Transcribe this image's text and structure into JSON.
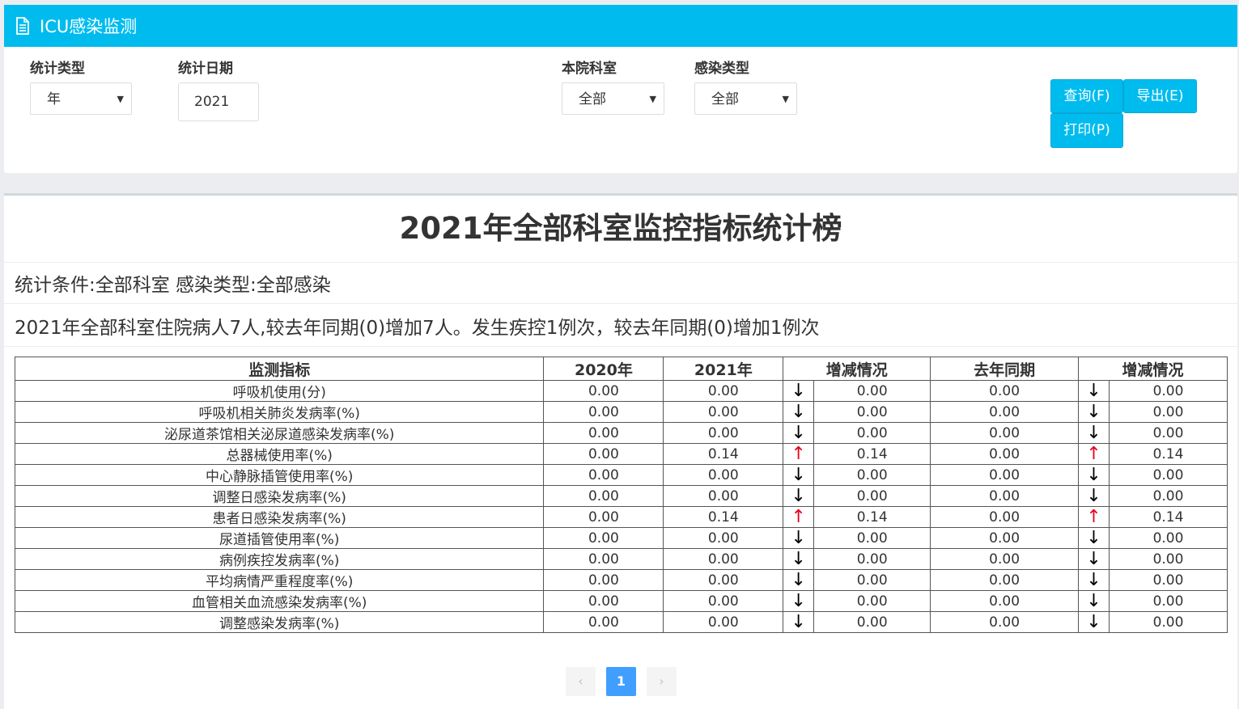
{
  "header": {
    "title": "ICU感染监测",
    "icon": "document-icon"
  },
  "filters": {
    "stat_type": {
      "label": "统计类型",
      "value": "年"
    },
    "stat_date": {
      "label": "统计日期",
      "value": "2021"
    },
    "department": {
      "label": "本院科室",
      "value": "全部"
    },
    "infection_type": {
      "label": "感染类型",
      "value": "全部"
    }
  },
  "buttons": {
    "query": "查询(F)",
    "export": "导出(E)",
    "print": "打印(P)"
  },
  "report": {
    "title": "2021年全部科室监控指标统计榜",
    "conditions": "统计条件:全部科室 感染类型:全部感染",
    "summary": "2021年全部科室住院病人7人,较去年同期(0)增加7人。发生疾控1例次，较去年同期(0)增加1例次"
  },
  "table": {
    "headers": [
      "监测指标",
      "2020年",
      "2021年",
      "增减情况",
      "去年同期",
      "增减情况"
    ],
    "rows": [
      {
        "name": "呼吸机使用(分)",
        "y2020": "0.00",
        "y2021": "0.00",
        "trend1": "↓",
        "change1": "0.00",
        "last": "0.00",
        "trend2": "↓",
        "change2": "0.00"
      },
      {
        "name": "呼吸机相关肺炎发病率(%)",
        "y2020": "0.00",
        "y2021": "0.00",
        "trend1": "↓",
        "change1": "0.00",
        "last": "0.00",
        "trend2": "↓",
        "change2": "0.00"
      },
      {
        "name": "泌尿道茶馆相关泌尿道感染发病率(%)",
        "y2020": "0.00",
        "y2021": "0.00",
        "trend1": "↓",
        "change1": "0.00",
        "last": "0.00",
        "trend2": "↓",
        "change2": "0.00"
      },
      {
        "name": "总器械使用率(%)",
        "y2020": "0.00",
        "y2021": "0.14",
        "trend1": "↑",
        "change1": "0.14",
        "last": "0.00",
        "trend2": "↑",
        "change2": "0.14"
      },
      {
        "name": "中心静脉插管使用率(%)",
        "y2020": "0.00",
        "y2021": "0.00",
        "trend1": "↓",
        "change1": "0.00",
        "last": "0.00",
        "trend2": "↓",
        "change2": "0.00"
      },
      {
        "name": "调整日感染发病率(%)",
        "y2020": "0.00",
        "y2021": "0.00",
        "trend1": "↓",
        "change1": "0.00",
        "last": "0.00",
        "trend2": "↓",
        "change2": "0.00"
      },
      {
        "name": "患者日感染发病率(%)",
        "y2020": "0.00",
        "y2021": "0.14",
        "trend1": "↑",
        "change1": "0.14",
        "last": "0.00",
        "trend2": "↑",
        "change2": "0.14"
      },
      {
        "name": "尿道插管使用率(%)",
        "y2020": "0.00",
        "y2021": "0.00",
        "trend1": "↓",
        "change1": "0.00",
        "last": "0.00",
        "trend2": "↓",
        "change2": "0.00"
      },
      {
        "name": "病例疾控发病率(%)",
        "y2020": "0.00",
        "y2021": "0.00",
        "trend1": "↓",
        "change1": "0.00",
        "last": "0.00",
        "trend2": "↓",
        "change2": "0.00"
      },
      {
        "name": "平均病情严重程度率(%)",
        "y2020": "0.00",
        "y2021": "0.00",
        "trend1": "↓",
        "change1": "0.00",
        "last": "0.00",
        "trend2": "↓",
        "change2": "0.00"
      },
      {
        "name": "血管相关血流感染发病率(%)",
        "y2020": "0.00",
        "y2021": "0.00",
        "trend1": "↓",
        "change1": "0.00",
        "last": "0.00",
        "trend2": "↓",
        "change2": "0.00"
      },
      {
        "name": "调整感染发病率(%)",
        "y2020": "0.00",
        "y2021": "0.00",
        "trend1": "↓",
        "change1": "0.00",
        "last": "0.00",
        "trend2": "↓",
        "change2": "0.00"
      }
    ]
  },
  "pagination": {
    "prev": "‹",
    "current": "1",
    "next": "›"
  },
  "colors": {
    "accent": "#00bcee",
    "up_arrow": "#e8001c",
    "page_active": "#409eff"
  }
}
